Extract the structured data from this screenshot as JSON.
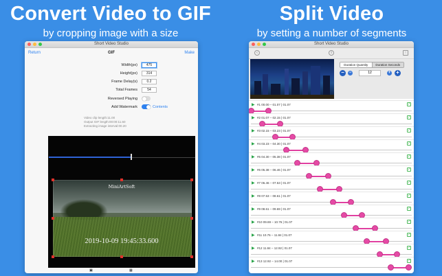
{
  "left_promo": {
    "headline": "Convert Video to GIF",
    "subline": "by cropping image with a size"
  },
  "right_promo": {
    "headline": "Split Video",
    "subline": "by setting a number of segments"
  },
  "gif_window": {
    "title": "Short Video Studio",
    "nav": {
      "return": "Return",
      "title": "GIF",
      "make": "Make"
    },
    "fields": [
      {
        "label": "Width(px)",
        "value": "475",
        "focused": true
      },
      {
        "label": "Height(px)",
        "value": "314",
        "focused": false
      },
      {
        "label": "Frame Delay(s)",
        "value": "0.2",
        "focused": false
      },
      {
        "label": "Total Frames",
        "value": "54",
        "focused": false
      }
    ],
    "reversed_playing": {
      "label": "Reversed Playing",
      "on": false
    },
    "add_watermark": {
      "label": "Add Watermark",
      "on": true,
      "contents_link": "Contents"
    },
    "info": [
      "Video clip length:11.00",
      "Output GIF length:00:00:11.60",
      "Extracting image interval:00.20"
    ],
    "preview": {
      "progress": 0.56,
      "watermark_text": "MiniArtSoft",
      "timestamp_text": "2019-10-09 19:45:33.600"
    },
    "icons": {
      "left": "crop-icon",
      "right": "grid-icon"
    }
  },
  "split_window": {
    "title": "Short Video Studio",
    "toolbar_icons": [
      "back-icon",
      "info-icon",
      "share-icon"
    ],
    "mode": {
      "options": [
        "Duration Quantity",
        "Duration Seconds"
      ],
      "selected": 0
    },
    "segment_count": "12",
    "segments": [
      {
        "label": "#1   00.00 – 01.07 | 01.07",
        "start": 0.0,
        "end": 0.11
      },
      {
        "label": "#2   01.07 – 02.15 | 01.07",
        "start": 0.07,
        "end": 0.18
      },
      {
        "label": "#3   02.15 – 03.23 | 01.07",
        "start": 0.15,
        "end": 0.26
      },
      {
        "label": "#4   03.23 – 04.30 | 01.07",
        "start": 0.22,
        "end": 0.34
      },
      {
        "label": "#5   04.30 – 05.38 | 01.07",
        "start": 0.29,
        "end": 0.41
      },
      {
        "label": "#6   05.38 – 06.46 | 01.07",
        "start": 0.36,
        "end": 0.48
      },
      {
        "label": "#7   06.46 – 07.53 | 01.07",
        "start": 0.43,
        "end": 0.55
      },
      {
        "label": "#8   07.53 – 08.61 | 01.07",
        "start": 0.51,
        "end": 0.62
      },
      {
        "label": "#9   08.61 – 09.69 | 01.07",
        "start": 0.58,
        "end": 0.69
      },
      {
        "label": "#10   09.69 – 10.76 | 01.07",
        "start": 0.65,
        "end": 0.77
      },
      {
        "label": "#11   10.76 – 11.84 | 01.07",
        "start": 0.72,
        "end": 0.84
      },
      {
        "label": "#12   11.84 – 12.92 | 01.07",
        "start": 0.8,
        "end": 0.91
      },
      {
        "label": "#13   12.92 – 14.00 | 01.07",
        "start": 0.87,
        "end": 0.98
      }
    ],
    "colors": {
      "accent": "#2e82f0",
      "segment_fill": "#e040a0",
      "play": "#2ba44a"
    }
  }
}
